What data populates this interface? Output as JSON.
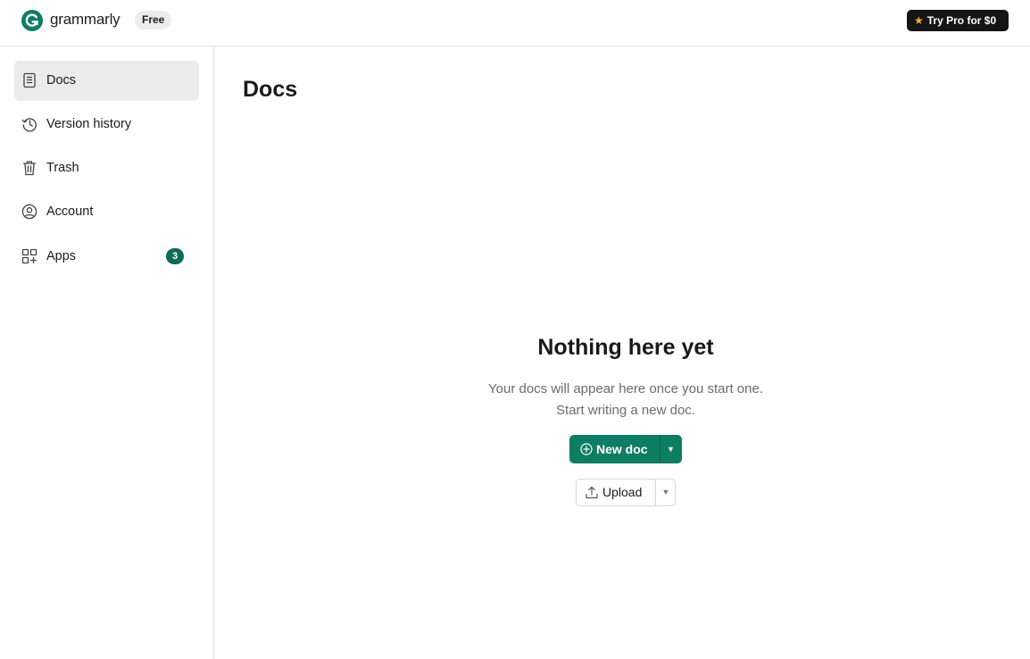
{
  "header": {
    "logo_text": "grammarly",
    "plan_badge": "Free",
    "pro_button_label": "Try Pro for $0",
    "pro_button_icon": "star-icon"
  },
  "sidebar": {
    "items": [
      {
        "label": "Docs",
        "icon": "document-icon",
        "active": true
      },
      {
        "label": "Version history",
        "icon": "history-icon"
      },
      {
        "label": "Trash",
        "icon": "trash-icon"
      },
      {
        "label": "Account",
        "icon": "account-icon"
      },
      {
        "label": "Apps",
        "icon": "apps-icon",
        "badge": "3"
      }
    ]
  },
  "main": {
    "title": "Docs",
    "empty_state": {
      "title": "Nothing here yet",
      "line1": "Your docs will appear here once you start one.",
      "line2": "Start writing a new doc."
    },
    "new_doc_label": "New doc",
    "upload_label": "Upload"
  },
  "colors": {
    "brand_green": "#0d7d63",
    "badge_green": "#0d6b58",
    "pro_button_bg": "#151515",
    "star": "#f5b32a"
  }
}
